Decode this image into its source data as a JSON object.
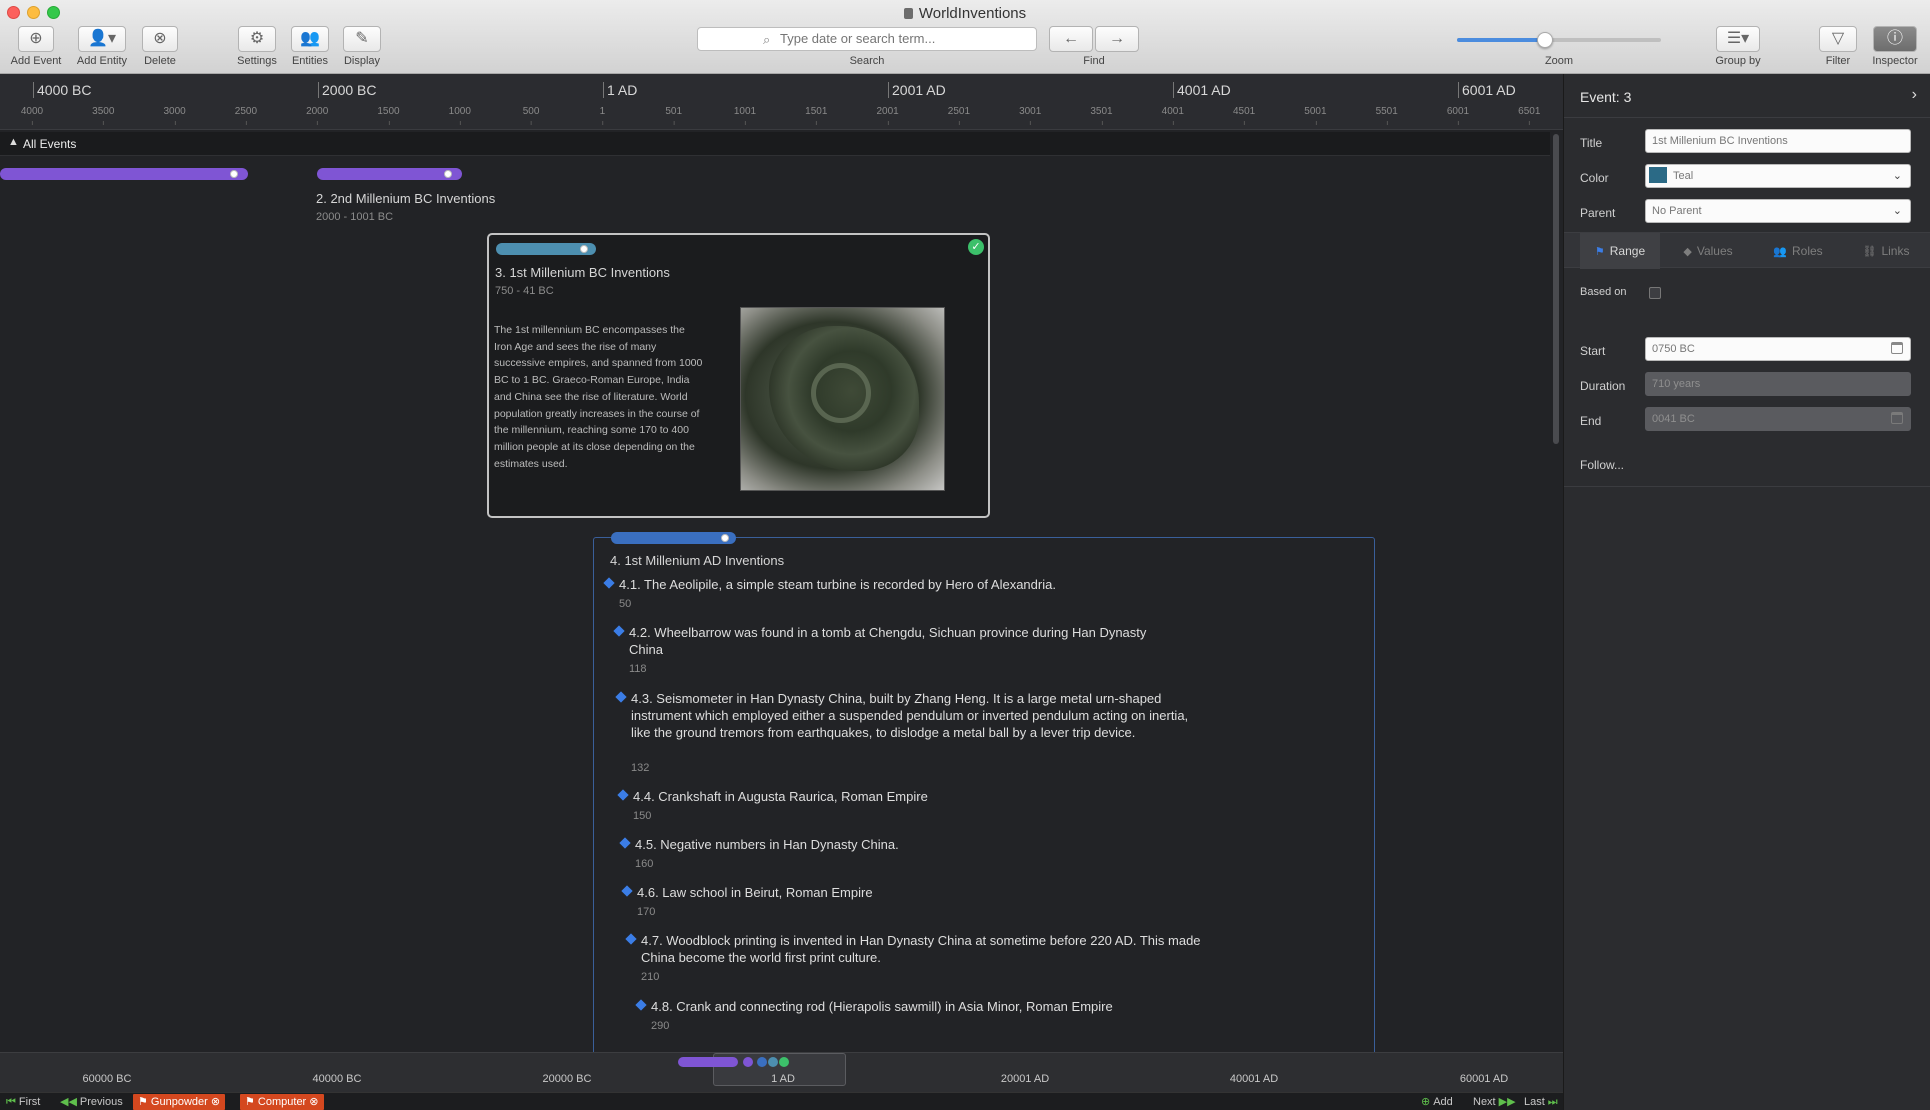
{
  "window": {
    "title": "WorldInventions"
  },
  "toolbar": {
    "add_event": "Add Event",
    "add_entity": "Add Entity",
    "delete": "Delete",
    "settings": "Settings",
    "entities": "Entities",
    "display": "Display",
    "search_placeholder": "Type date or search term...",
    "search_label": "Search",
    "find_label": "Find",
    "zoom_label": "Zoom",
    "zoom_level": 0.43,
    "group_by": "Group by",
    "filter": "Filter",
    "inspector": "Inspector"
  },
  "ruler": {
    "major": [
      "4000 BC",
      "2000 BC",
      "1 AD",
      "2001 AD",
      "4001 AD",
      "6001 AD"
    ],
    "minor": [
      "4000",
      "3500",
      "3000",
      "2500",
      "2000",
      "1500",
      "1000",
      "500",
      "1",
      "501",
      "1001",
      "1501",
      "2001",
      "2501",
      "3001",
      "3501",
      "4001",
      "4501",
      "5001",
      "5501",
      "6001",
      "6501"
    ]
  },
  "group": {
    "label": "All Events"
  },
  "events": {
    "e2": {
      "title": "2. 2nd Millenium BC Inventions",
      "range": "2000 - 1001 BC"
    },
    "e3": {
      "title": "3. 1st Millenium BC Inventions",
      "range": "750 - 41 BC",
      "description": "The 1st millennium BC encompasses the Iron Age and sees the rise of many successive empires, and spanned from 1000 BC to 1 BC. Graeco-Roman Europe, India and China see the rise of literature. World population greatly increases in the course of the millennium, reaching some 170 to 400 million people at its close depending on the estimates used."
    },
    "e4": {
      "title": "4. 1st Millenium AD Inventions",
      "children": [
        {
          "text": "4.1. The Aeolipile, a simple steam turbine is recorded by Hero of Alexandria.",
          "year": "50"
        },
        {
          "text": "4.2. Wheelbarrow was found in a tomb at Chengdu, Sichuan province during Han Dynasty China",
          "year": "118"
        },
        {
          "text": "4.3. Seismometer in Han Dynasty China, built by Zhang Heng. It is a large metal urn-shaped instrument which employed either a suspended pendulum or inverted pendulum acting on inertia, like the ground tremors from earthquakes, to dislodge a metal ball by a lever trip device.",
          "year": "132"
        },
        {
          "text": "4.4. Crankshaft in Augusta Raurica, Roman Empire",
          "year": "150"
        },
        {
          "text": "4.5. Negative numbers in Han Dynasty China.",
          "year": "160"
        },
        {
          "text": "4.6. Law school in Beirut, Roman Empire",
          "year": "170"
        },
        {
          "text": "4.7. Woodblock printing is invented in Han Dynasty China at sometime before 220 AD. This made China become the world first print culture.",
          "year": "210"
        },
        {
          "text": "4.8. Crank and connecting rod (Hierapolis sawmill) in Asia Minor, Roman Empire",
          "year": "290"
        }
      ]
    }
  },
  "overview": {
    "labels": [
      "60000 BC",
      "40000 BC",
      "20000 BC",
      "1 AD",
      "20001 AD",
      "40001 AD",
      "60001 AD"
    ]
  },
  "bottombar": {
    "first": "First",
    "previous": "Previous",
    "tag1": "Gunpowder",
    "tag2": "Computer",
    "add": "Add",
    "next": "Next",
    "last": "Last"
  },
  "inspector": {
    "header": "Event: 3",
    "title_label": "Title",
    "title_value": "1st Millenium BC Inventions",
    "color_label": "Color",
    "color_value": "Teal",
    "color_hex": "#2b6a86",
    "parent_label": "Parent",
    "parent_value": "No Parent",
    "tabs": [
      "Range",
      "Values",
      "Roles",
      "Links"
    ],
    "based_on_label": "Based on",
    "start_label": "Start",
    "start_value": "0750 BC",
    "duration_label": "Duration",
    "duration_value": "710 years",
    "end_label": "End",
    "end_value": "0041 BC",
    "follow_label": "Follow..."
  },
  "colors": {
    "accent": "#3b7de6",
    "purple": "#7f55d4",
    "teal": "#4d8fb0"
  }
}
